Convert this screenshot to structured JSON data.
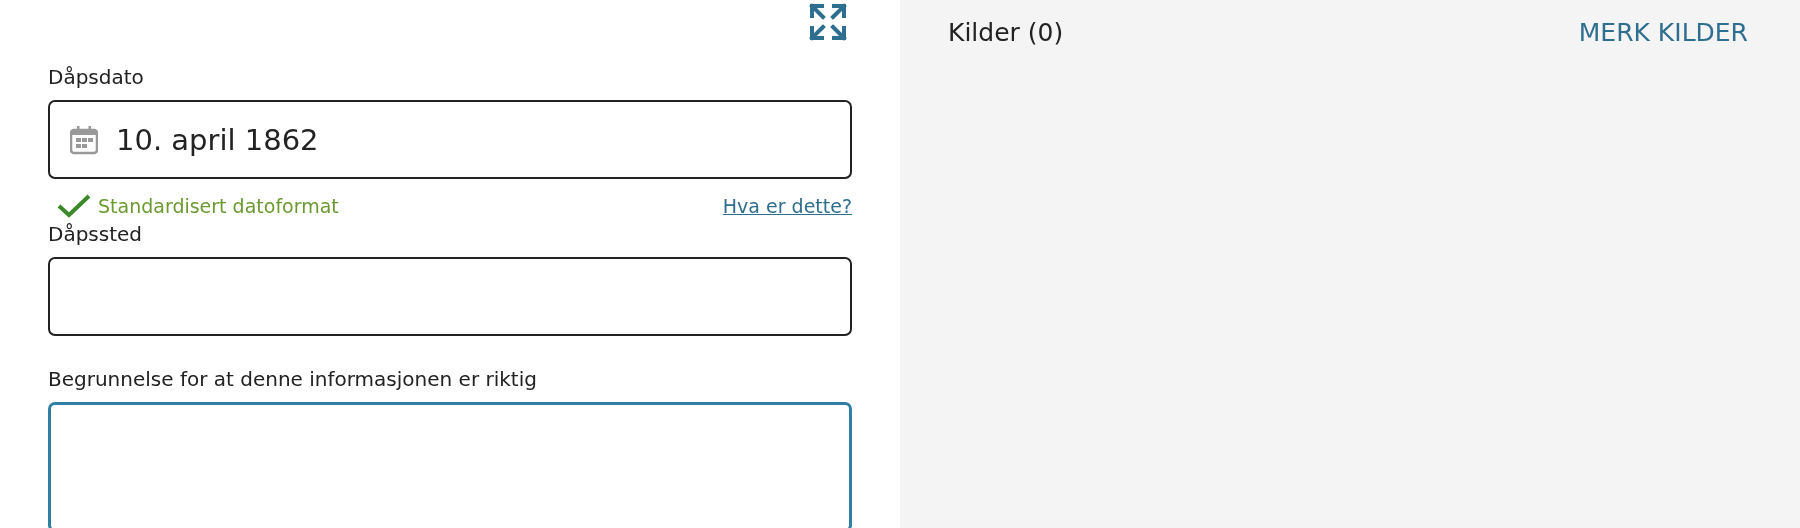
{
  "form": {
    "fields": [
      {
        "kind": "date",
        "label": "Dåpsdato",
        "value": "10. april 1862",
        "focused": false,
        "validation": {
          "message": "Standardisert datoformat",
          "link": "Hva er dette?"
        }
      },
      {
        "kind": "text",
        "label": "Dåpssted",
        "focused": false
      },
      {
        "kind": "textarea",
        "label": "Begrunnelse for at denne informasjonen er riktig",
        "focused": true
      }
    ]
  },
  "sources": {
    "title": "Kilder (0)",
    "action": "MERK KILDER"
  }
}
